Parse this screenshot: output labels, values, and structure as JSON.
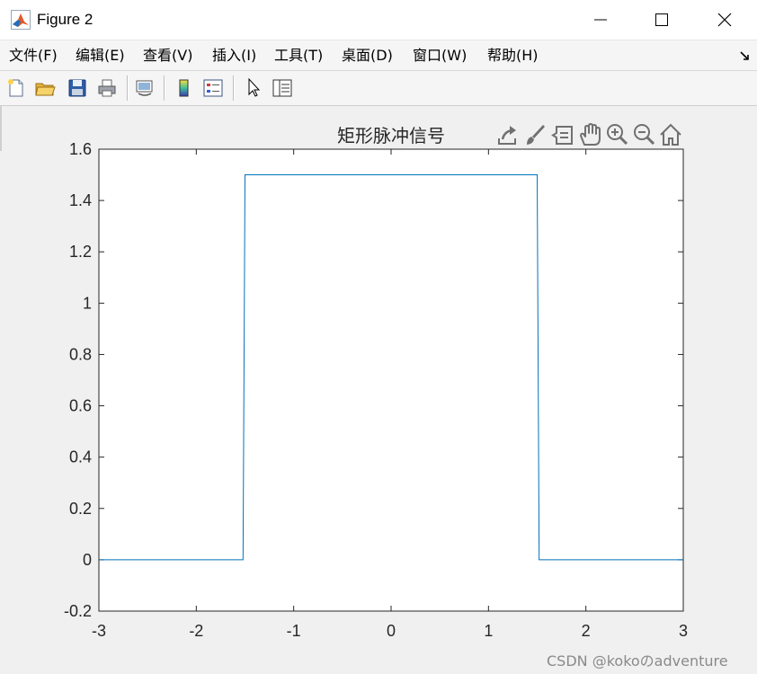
{
  "window": {
    "title": "Figure 2"
  },
  "menu": {
    "items": [
      "文件(F)",
      "编辑(E)",
      "查看(V)",
      "插入(I)",
      "工具(T)",
      "桌面(D)",
      "窗口(W)",
      "帮助(H)"
    ]
  },
  "toolbar": {
    "icons": [
      "new-figure-icon",
      "open-file-icon",
      "save-icon",
      "print-icon",
      "link-plot-icon",
      "colorbar-icon",
      "legend-icon",
      "edit-plot-arrow-icon",
      "property-inspector-icon"
    ]
  },
  "axes_toolbar": {
    "icons": [
      "export-icon",
      "brush-icon",
      "data-tips-icon",
      "pan-hand-icon",
      "zoom-in-icon",
      "zoom-out-icon",
      "home-icon"
    ]
  },
  "chart_data": {
    "type": "line",
    "title": "矩形脉冲信号",
    "xlabel": "",
    "ylabel": "",
    "xlim": [
      -3,
      3
    ],
    "ylim": [
      -0.2,
      1.6
    ],
    "xticks": [
      -3,
      -2,
      -1,
      0,
      1,
      2,
      3
    ],
    "yticks": [
      -0.2,
      0,
      0.2,
      0.4,
      0.6,
      0.8,
      1,
      1.2,
      1.4,
      1.6
    ],
    "grid": false,
    "series": [
      {
        "color": "#0072bd",
        "x": [
          -3,
          -1.52,
          -1.5,
          1.5,
          1.52,
          3
        ],
        "y": [
          0,
          0,
          1.5,
          1.5,
          0,
          0
        ]
      }
    ]
  },
  "watermark": "CSDN @kokoのadventure"
}
